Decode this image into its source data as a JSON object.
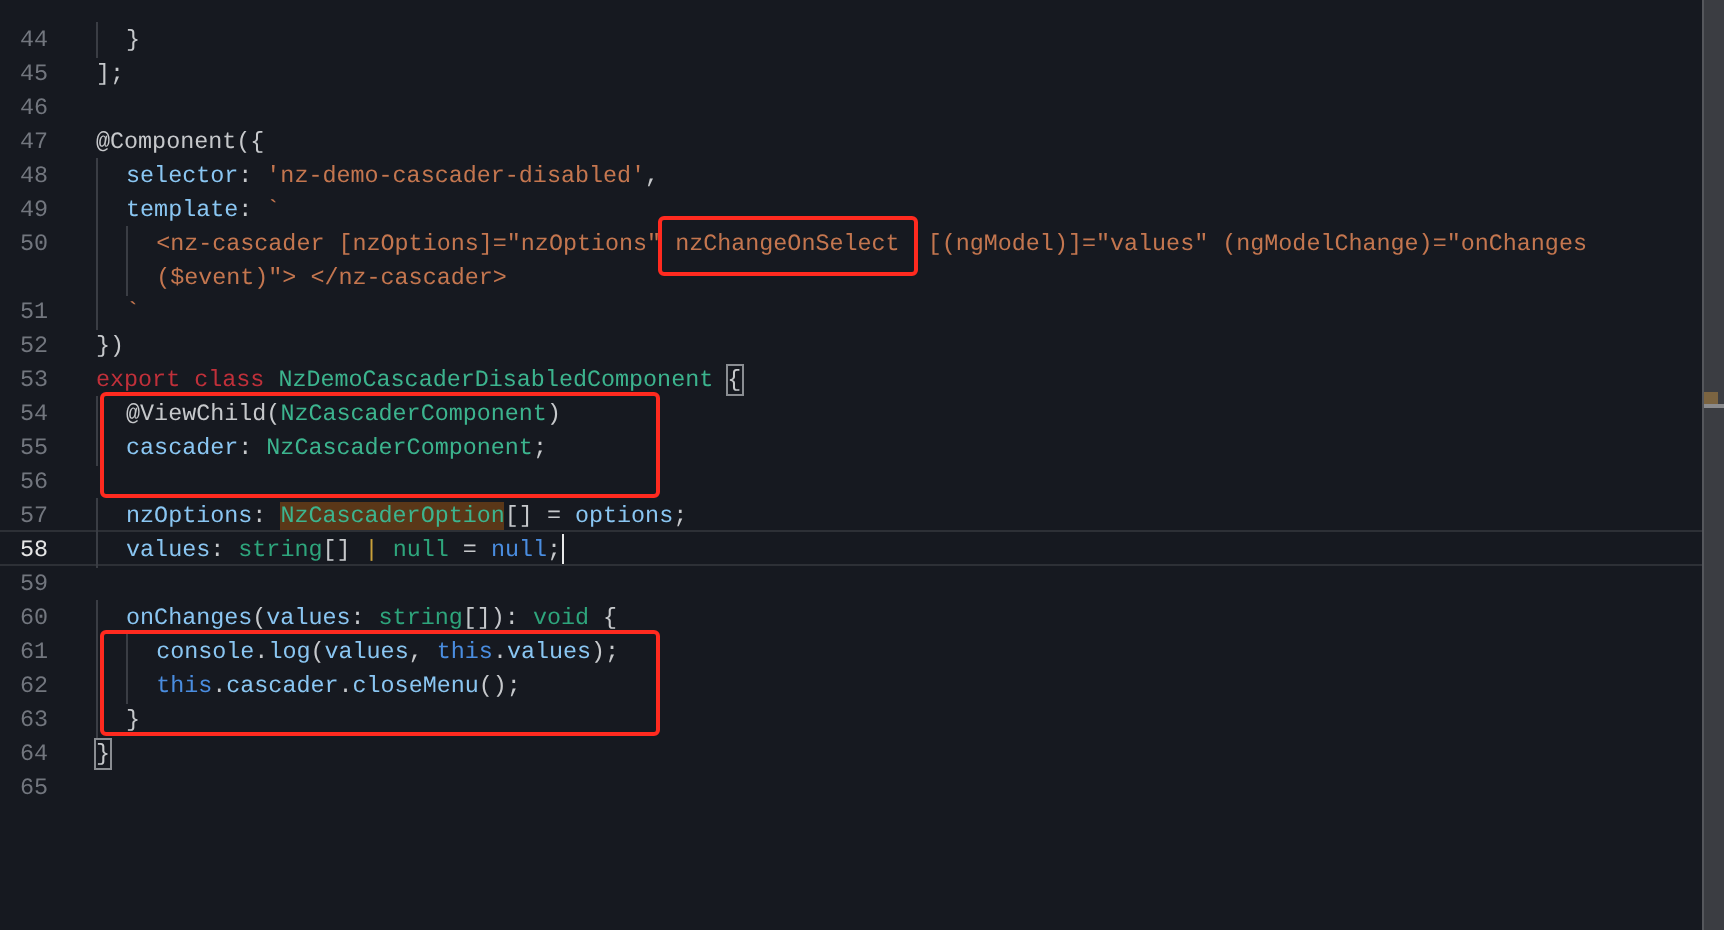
{
  "editor": {
    "lines": [
      {
        "number": "44",
        "current": false,
        "boxed": false,
        "tokens": [
          {
            "text": "  }",
            "kind": "punct"
          }
        ]
      },
      {
        "number": "45",
        "current": false,
        "boxed": false,
        "tokens": [
          {
            "text": "];",
            "kind": "punct"
          }
        ]
      },
      {
        "number": "46",
        "current": false,
        "boxed": false
      },
      {
        "number": "47",
        "current": false,
        "boxed": false,
        "tokens": [
          {
            "text": "@Component({",
            "kind": "punct"
          }
        ]
      },
      {
        "number": "48",
        "current": false,
        "boxed": false,
        "tokens": [
          {
            "text": "  selector",
            "kind": "prop"
          },
          {
            "text": ": ",
            "kind": "punct"
          },
          {
            "text": "'nz-demo-cascader-disabled'",
            "kind": "string"
          },
          {
            "text": ",",
            "kind": "punct"
          }
        ]
      },
      {
        "number": "49",
        "current": false,
        "boxed": false,
        "tokens": [
          {
            "text": "  template",
            "kind": "prop"
          },
          {
            "text": ": ",
            "kind": "punct"
          },
          {
            "text": "`",
            "kind": "string"
          }
        ]
      },
      {
        "number": "50",
        "current": false,
        "boxed": false,
        "tokens": [
          {
            "text": "    <nz-cascader [nzOptions]=\"nzOptions\" ",
            "kind": "string"
          },
          {
            "text": "nzChangeOnSelect",
            "kind": "string",
            "boxed": true
          },
          {
            "text": "  [(ngModel)]=\"values\" (ngModelChange)=\"onChanges",
            "kind": "string",
            "boxed": false
          }
        ]
      },
      {
        "current": false,
        "boxed": false,
        "tokens": [
          {
            "text": "    ($event)\"> </nz-cascader>",
            "kind": "string"
          }
        ]
      },
      {
        "number": "51",
        "current": false,
        "boxed": false,
        "tokens": [
          {
            "text": "  `",
            "kind": "string"
          }
        ]
      },
      {
        "number": "52",
        "current": false,
        "boxed": false,
        "tokens": [
          {
            "text": "})",
            "kind": "punct"
          }
        ]
      },
      {
        "number": "53",
        "current": false,
        "boxed": false,
        "tokens": [
          {
            "text": "export class ",
            "kind": "keyword"
          },
          {
            "text": "NzDemoCascaderDisabledComponent ",
            "kind": "type"
          },
          {
            "text": "{",
            "kind": "punct",
            "bracket": true
          }
        ]
      },
      {
        "number": "54",
        "current": false,
        "boxed": true,
        "tokens": [
          {
            "text": "  @ViewChild(",
            "kind": "punct"
          },
          {
            "text": "NzCascaderComponent",
            "kind": "type"
          },
          {
            "text": ")",
            "kind": "punct"
          }
        ]
      },
      {
        "number": "55",
        "current": false,
        "boxed": true,
        "tokens": [
          {
            "text": "  cascader",
            "kind": "prop"
          },
          {
            "text": ": ",
            "kind": "punct"
          },
          {
            "text": "NzCascaderComponent",
            "kind": "type"
          },
          {
            "text": ";",
            "kind": "punct"
          }
        ]
      },
      {
        "number": "56",
        "current": false,
        "boxed": true
      },
      {
        "number": "57",
        "current": false,
        "boxed": false,
        "tokens": [
          {
            "text": "  nzOptions",
            "kind": "prop"
          },
          {
            "text": ": ",
            "kind": "punct"
          },
          {
            "text": "NzCascaderOption",
            "kind": "type",
            "match": true
          },
          {
            "text": "[] = ",
            "kind": "punct"
          },
          {
            "text": "options",
            "kind": "prop"
          },
          {
            "text": ";",
            "kind": "punct"
          }
        ]
      },
      {
        "number": "58",
        "current": true,
        "boxed": false,
        "tokens": [
          {
            "text": "  values",
            "kind": "prop"
          },
          {
            "text": ": ",
            "kind": "punct"
          },
          {
            "text": "string",
            "kind": "builtin"
          },
          {
            "text": "[] ",
            "kind": "punct"
          },
          {
            "text": "| ",
            "kind": "operator"
          },
          {
            "text": "null",
            "kind": "builtin"
          },
          {
            "text": " = ",
            "kind": "punct"
          },
          {
            "text": "null",
            "kind": "constant"
          },
          {
            "text": ";",
            "kind": "punct"
          }
        ]
      },
      {
        "number": "59",
        "current": false,
        "boxed": false
      },
      {
        "number": "60",
        "current": false,
        "boxed": false,
        "tokens": [
          {
            "text": "  onChanges",
            "kind": "prop"
          },
          {
            "text": "(",
            "kind": "punct"
          },
          {
            "text": "values",
            "kind": "prop"
          },
          {
            "text": ": ",
            "kind": "punct"
          },
          {
            "text": "string",
            "kind": "builtin"
          },
          {
            "text": "[]): ",
            "kind": "punct"
          },
          {
            "text": "void",
            "kind": "builtin"
          },
          {
            "text": " {",
            "kind": "punct"
          }
        ]
      },
      {
        "number": "61",
        "current": false,
        "boxed": true,
        "tokens": [
          {
            "text": "    console",
            "kind": "prop"
          },
          {
            "text": ".",
            "kind": "punct"
          },
          {
            "text": "log",
            "kind": "prop"
          },
          {
            "text": "(",
            "kind": "punct"
          },
          {
            "text": "values",
            "kind": "prop"
          },
          {
            "text": ", ",
            "kind": "punct"
          },
          {
            "text": "this",
            "kind": "constant"
          },
          {
            "text": ".",
            "kind": "punct"
          },
          {
            "text": "values",
            "kind": "prop"
          },
          {
            "text": ");",
            "kind": "punct"
          }
        ]
      },
      {
        "number": "62",
        "current": false,
        "boxed": true,
        "tokens": [
          {
            "text": "    this",
            "kind": "constant"
          },
          {
            "text": ".",
            "kind": "punct"
          },
          {
            "text": "cascader",
            "kind": "prop"
          },
          {
            "text": ".",
            "kind": "punct"
          },
          {
            "text": "closeMenu",
            "kind": "prop"
          },
          {
            "text": "();",
            "kind": "punct"
          }
        ]
      },
      {
        "number": "63",
        "current": false,
        "boxed": true,
        "tokens": [
          {
            "text": "  }",
            "kind": "punct"
          }
        ]
      },
      {
        "number": "64",
        "current": false,
        "boxed": false,
        "tokens": [
          {
            "text": "}",
            "kind": "punct",
            "bracket": true
          }
        ]
      },
      {
        "number": "65",
        "current": false,
        "boxed": false
      }
    ]
  }
}
